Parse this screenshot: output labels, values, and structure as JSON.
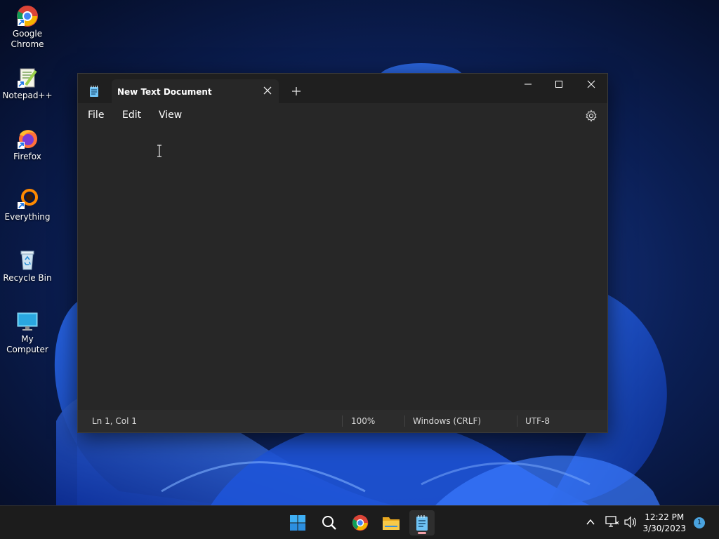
{
  "desktop": {
    "icons": [
      {
        "label_line1": "Google",
        "label_line2": "Chrome",
        "icon": "chrome-icon"
      },
      {
        "label": "Notepad++",
        "icon": "notepadpp-icon"
      },
      {
        "label": "Firefox",
        "icon": "firefox-icon"
      },
      {
        "label": "Everything",
        "icon": "everything-icon"
      },
      {
        "label": "Recycle Bin",
        "icon": "recycle-bin-icon"
      },
      {
        "label": "My Computer",
        "icon": "my-computer-icon"
      }
    ]
  },
  "notepad": {
    "tab_title": "New Text Document",
    "menu": [
      "File",
      "Edit",
      "View"
    ],
    "status": {
      "position": "Ln 1, Col 1",
      "zoom": "100%",
      "line_ending": "Windows (CRLF)",
      "encoding": "UTF-8"
    }
  },
  "taskbar": {
    "time": "12:22 PM",
    "date": "3/30/2023",
    "notification_count": "1"
  },
  "colors": {
    "accent": "#0078d4",
    "window_bg": "#272727",
    "titlebar_bg": "#1f1f1f"
  }
}
